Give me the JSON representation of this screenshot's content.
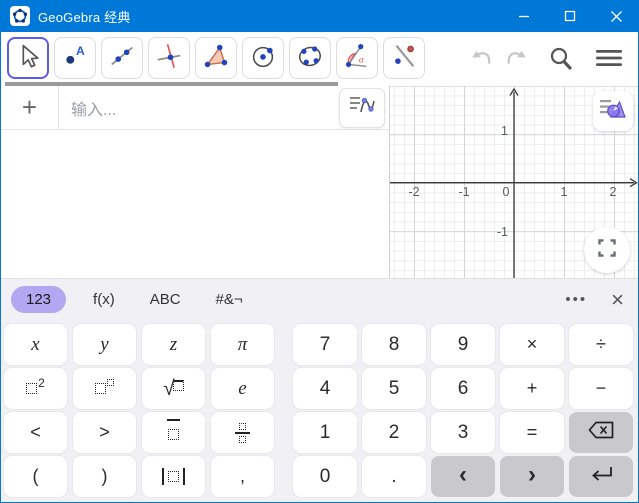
{
  "window": {
    "title": "GeoGebra 经典"
  },
  "toolbar": {
    "tools": [
      "move",
      "point",
      "line",
      "perpendicular-line",
      "polygon",
      "circle-center-point",
      "conic-through-points",
      "angle",
      "reflect-about-line"
    ],
    "actions": [
      "undo",
      "redo",
      "search",
      "menu"
    ]
  },
  "algebra": {
    "add": "+",
    "input_placeholder": "输入..."
  },
  "graphics": {
    "x_ticks": [
      "-2",
      "-1",
      "0",
      "1",
      "2"
    ],
    "y_ticks": [
      "1",
      "-1"
    ]
  },
  "keyboard": {
    "tabs": [
      "123",
      "f(x)",
      "ABC",
      "#&¬"
    ],
    "active_tab": "123",
    "more": "•••",
    "close": "×",
    "keys": {
      "x": "x",
      "y": "y",
      "z": "z",
      "pi": "π",
      "e": "e",
      "lt": "<",
      "gt": ">",
      "lparen": "(",
      "rparen": ")",
      "comma": ",",
      "n7": "7",
      "n8": "8",
      "n9": "9",
      "times": "×",
      "divide": "÷",
      "n4": "4",
      "n5": "5",
      "n6": "6",
      "plus": "+",
      "minus": "−",
      "n1": "1",
      "n2": "2",
      "n3": "3",
      "equals": "=",
      "n0": "0",
      "decimal": ".",
      "left": "‹",
      "right": "›"
    }
  },
  "colors": {
    "titlebar": "#0078D7",
    "accent_selected": "#5B5BF1",
    "tab_pill": "#B2A7F0",
    "point_blue": "#2244BB",
    "gray_key": "#C8C8CD"
  }
}
